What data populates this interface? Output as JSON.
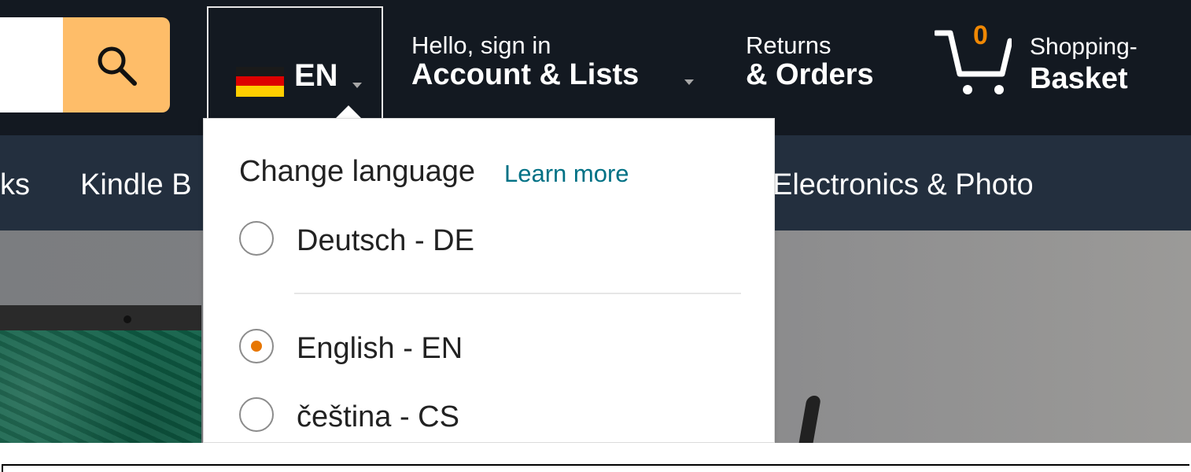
{
  "header": {
    "search": {
      "input_value": ""
    },
    "language": {
      "code": "EN"
    },
    "account": {
      "greeting": "Hello, sign in",
      "label": "Account & Lists"
    },
    "returns": {
      "line1": "Returns",
      "line2": "& Orders"
    },
    "cart": {
      "count": "0",
      "line1": "Shopping-",
      "line2": "Basket"
    }
  },
  "subnav": {
    "items": [
      "ks",
      "Kindle B",
      "Electronics & Photo"
    ]
  },
  "language_menu": {
    "title": "Change language",
    "learn_more": "Learn more",
    "options": [
      "Deutsch - DE",
      "English - EN",
      "čeština - CS"
    ],
    "selected": "English - EN"
  },
  "colors": {
    "header_bg": "#131921",
    "subnav_bg": "#232f3e",
    "search_button": "#febd69",
    "link": "#007185",
    "radio_selected": "#e77600",
    "cart_count": "#f08804"
  },
  "icons": {
    "search": "search-icon",
    "cart": "cart-icon",
    "flag": "germany-flag-icon",
    "caret": "chevron-down-icon"
  }
}
